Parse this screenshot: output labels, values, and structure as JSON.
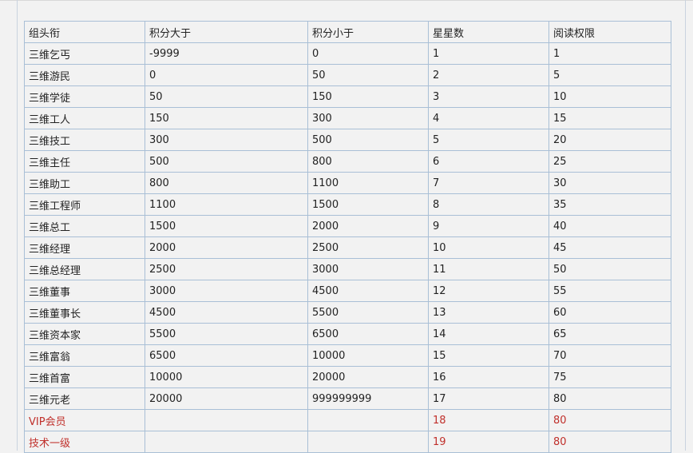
{
  "table": {
    "headers": [
      "组头衔",
      "积分大于",
      "积分小于",
      "星星数",
      "阅读权限"
    ],
    "rows": [
      [
        "三维乞丐",
        "-9999",
        "0",
        "1",
        "1"
      ],
      [
        "三维游民",
        "0",
        "50",
        "2",
        "5"
      ],
      [
        "三维学徒",
        "50",
        "150",
        "3",
        "10"
      ],
      [
        "三维工人",
        "150",
        "300",
        "4",
        "15"
      ],
      [
        "三维技工",
        "300",
        "500",
        "5",
        "20"
      ],
      [
        "三维主任",
        "500",
        "800",
        "6",
        "25"
      ],
      [
        "三维助工",
        "800",
        "1100",
        "7",
        "30"
      ],
      [
        "三维工程师",
        "1100",
        "1500",
        "8",
        "35"
      ],
      [
        "三维总工",
        "1500",
        "2000",
        "9",
        "40"
      ],
      [
        "三维经理",
        "2000",
        "2500",
        "10",
        "45"
      ],
      [
        "三维总经理",
        "2500",
        "3000",
        "11",
        "50"
      ],
      [
        "三维董事",
        "3000",
        "4500",
        "12",
        "55"
      ],
      [
        "三维董事长",
        "4500",
        "5500",
        "13",
        "60"
      ],
      [
        "三维资本家",
        "5500",
        "6500",
        "14",
        "65"
      ],
      [
        "三维富翁",
        "6500",
        "10000",
        "15",
        "70"
      ],
      [
        "三维首富",
        "10000",
        "20000",
        "16",
        "75"
      ],
      [
        "三维元老",
        "20000",
        "999999999",
        "17",
        "80"
      ]
    ],
    "special_rows": [
      [
        "VIP会员",
        "",
        "",
        "18",
        "80"
      ],
      [
        "技术一级",
        "",
        "",
        "19",
        "80"
      ]
    ]
  },
  "colors": {
    "border": "#a9bfd6",
    "special_text": "#c0302b",
    "background": "#f2f2f2"
  }
}
